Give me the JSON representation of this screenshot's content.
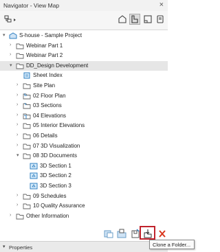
{
  "window": {
    "title": "Navigator - View Map"
  },
  "toolbar": {
    "icons": [
      "navigator-dropdown-icon",
      "project-map-icon",
      "view-map-icon",
      "layout-book-icon",
      "publisher-sets-icon"
    ]
  },
  "tree": {
    "items": [
      {
        "label": "S-house - Sample Project",
        "level": 0,
        "arrow": "▾",
        "icon": "project-icon"
      },
      {
        "label": "Webinar Part 1",
        "level": 1,
        "arrow": "›",
        "icon": "folder-icon"
      },
      {
        "label": "Webinar Part 2",
        "level": 1,
        "arrow": "›",
        "icon": "folder-icon"
      },
      {
        "label": "DD_Design Development",
        "level": 1,
        "arrow": "▾",
        "icon": "folder-icon",
        "selected": true
      },
      {
        "label": "Sheet Index",
        "level": 2,
        "arrow": "",
        "icon": "index-icon"
      },
      {
        "label": "Site Plan",
        "level": 2,
        "arrow": "›",
        "icon": "folder-icon"
      },
      {
        "label": "02 Floor Plan",
        "level": 2,
        "arrow": "›",
        "icon": "floorplan-icon"
      },
      {
        "label": "03 Sections",
        "level": 2,
        "arrow": "›",
        "icon": "section-icon"
      },
      {
        "label": "04 Elevations",
        "level": 2,
        "arrow": "›",
        "icon": "elevation-icon"
      },
      {
        "label": "05 Interior Elevations",
        "level": 2,
        "arrow": "›",
        "icon": "folder-icon"
      },
      {
        "label": "06 Details",
        "level": 2,
        "arrow": "›",
        "icon": "folder-icon"
      },
      {
        "label": "07 3D Visualization",
        "level": 2,
        "arrow": "›",
        "icon": "folder-icon"
      },
      {
        "label": "08 3D Documents",
        "level": 2,
        "arrow": "▾",
        "icon": "folder-icon"
      },
      {
        "label": "3D Section 1",
        "level": 3,
        "arrow": "",
        "icon": "3d-doc-icon"
      },
      {
        "label": "3D Section 2",
        "level": 3,
        "arrow": "",
        "icon": "3d-doc-icon"
      },
      {
        "label": "3D Section 3",
        "level": 3,
        "arrow": "",
        "icon": "3d-doc-icon"
      },
      {
        "label": "09 Schedules",
        "level": 2,
        "arrow": "›",
        "icon": "folder-icon"
      },
      {
        "label": "10 Quality Assurance",
        "level": 2,
        "arrow": "›",
        "icon": "folder-icon"
      },
      {
        "label": "Other Information",
        "level": 1,
        "arrow": "›",
        "icon": "folder-icon"
      }
    ]
  },
  "bottom": {
    "icons": [
      "new-view-icon",
      "new-folder-icon",
      "save-view-icon",
      "clone-folder-icon",
      "delete-icon"
    ],
    "tooltip": "Clone a Folder..."
  },
  "properties": {
    "label": "Properties"
  },
  "colors": {
    "highlight": "#c0222c",
    "delete": "#d9361c",
    "icon_blue": "#2f7fc1"
  }
}
